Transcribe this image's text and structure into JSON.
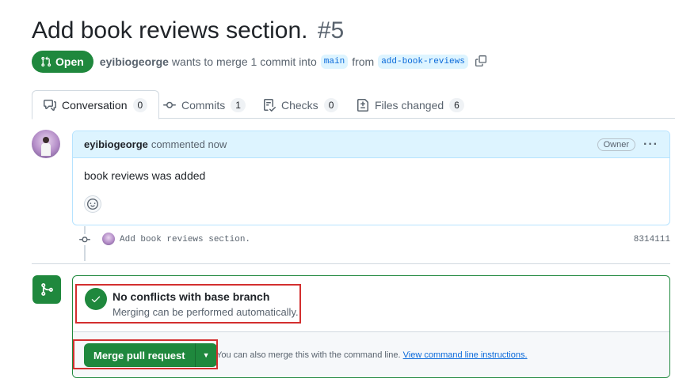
{
  "pr": {
    "title": "Add book reviews section.",
    "number": "#5",
    "state": "Open",
    "author": "eyibiogeorge",
    "merge_text": "wants to merge 1 commit into",
    "base_branch": "main",
    "from_text": "from",
    "head_branch": "add-book-reviews"
  },
  "tabs": [
    {
      "label": "Conversation",
      "count": "0",
      "icon": "comment-discussion-icon"
    },
    {
      "label": "Commits",
      "count": "1",
      "icon": "git-commit-icon"
    },
    {
      "label": "Checks",
      "count": "0",
      "icon": "checklist-icon"
    },
    {
      "label": "Files changed",
      "count": "6",
      "icon": "file-diff-icon"
    }
  ],
  "comment": {
    "author": "eyibiogeorge",
    "action": "commented now",
    "role": "Owner",
    "body": "book reviews was added"
  },
  "commit": {
    "message": "Add book reviews section.",
    "sha": "8314111"
  },
  "merge": {
    "status_title": "No conflicts with base branch",
    "status_subtitle": "Merging can be performed automatically.",
    "button_label": "Merge pull request",
    "hint_text": "You can also merge this with the command line.",
    "hint_link": "View command line instructions."
  },
  "colors": {
    "green": "#1f883d",
    "blue": "#0969da",
    "highlight": "#d32f2f"
  }
}
